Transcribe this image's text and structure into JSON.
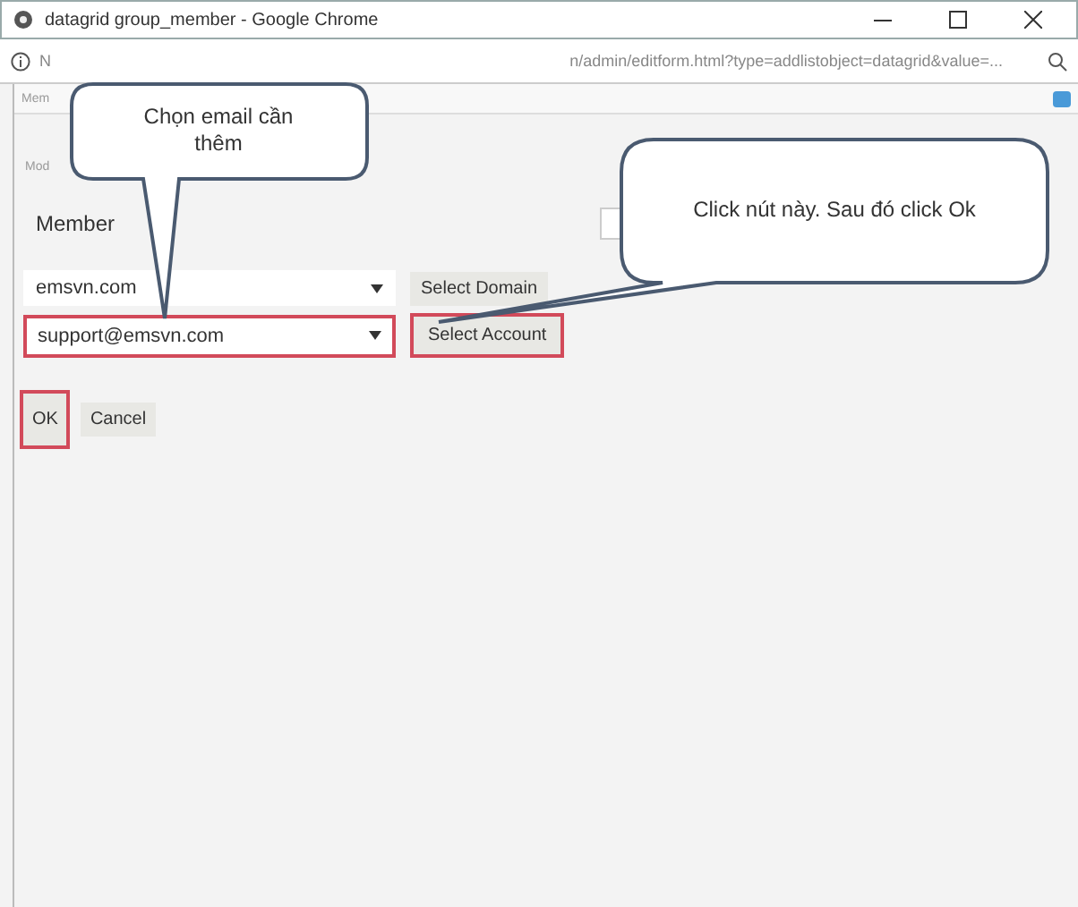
{
  "window": {
    "title": "datagrid group_member - Google Chrome"
  },
  "address_bar": {
    "visible_start": "N",
    "visible_end": "n/admin/editform.html?type=addlistobject=datagrid&value=..."
  },
  "toolbar": {
    "label": "Mem"
  },
  "form": {
    "section_label": "Mod",
    "field_label": "Member",
    "rows": [
      {
        "select_value": "emsvn.com",
        "button": "Select Domain",
        "highlighted": false
      },
      {
        "select_value": "support@emsvn.com",
        "button": "Select Account",
        "highlighted": true
      }
    ],
    "actions": [
      {
        "label": "OK",
        "highlighted": true
      },
      {
        "label": "Cancel",
        "highlighted": false
      }
    ]
  },
  "callouts": [
    {
      "text": "Chọn email cần thêm"
    },
    {
      "text": "Click nút này. Sau đó click Ok"
    }
  ]
}
